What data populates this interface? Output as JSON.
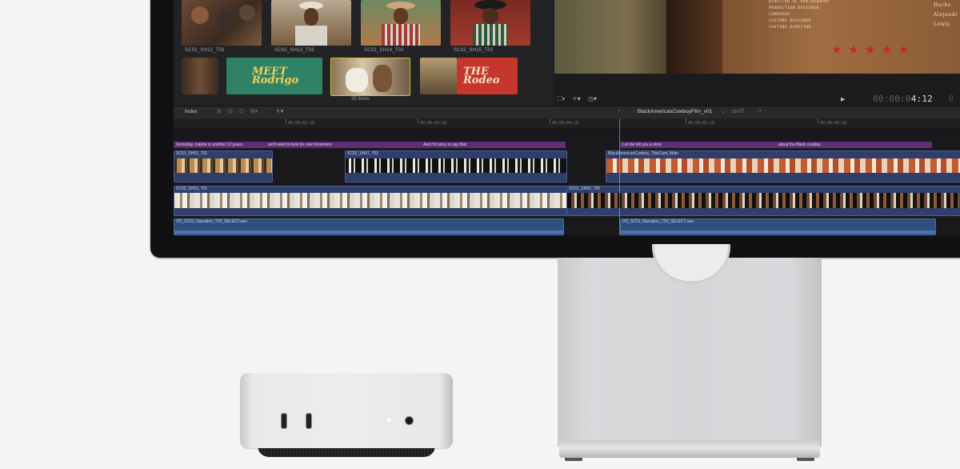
{
  "browser": {
    "clips": [
      {
        "label": "SC02_SH12_T03"
      },
      {
        "label": "SC02_SH13_T03"
      },
      {
        "label": "SC02_SH14_T02"
      },
      {
        "label": "SC02_SH15_T02"
      }
    ],
    "items_count": "35 items"
  },
  "title_cards": [
    "MEET Rodrigo",
    "THE Rodeo"
  ],
  "viewer": {
    "credits": [
      "DIRECTOR OF PHOTOGRAPHY",
      "PRODUCTION DESIGNER",
      "COMPOSER",
      "COSTUME DESIGNER",
      "CASTING DIRECTOR"
    ],
    "credit_names": [
      "Harbo",
      "Alejandr",
      "Lewis"
    ],
    "timecode_dim": "00:00:0",
    "timecode": "4:12",
    "star_rating": 5
  },
  "timeline": {
    "index_label": "Index",
    "project_name": "BlackAmericanCowboyFilm_v01",
    "project_duration": "16:07",
    "ruler": [
      "00:00:02:10",
      "00:00:03:10",
      "00:00:04:10",
      "00:00:05:10",
      "00:00:06:10"
    ],
    "captions": [
      "Someday, maybe in another 12 years,",
      "we'll need to look for new horsemen",
      "And I'm sorry to say that.",
      "Let me tell you a story",
      "about the Black cowboy."
    ],
    "clips_upper": [
      "SC01_SH01_T01",
      "SC02_SH07_T01",
      "BlackAmericanCowboy_TitleCard_Main"
    ],
    "clips_main": [
      "SC02_SH10_T01",
      "SC01_SH02_T05"
    ],
    "audio": [
      "VO_SC01_Narration_T03_SELECT.wav",
      "VO_SC01_Narration_T03_SELECT.wav"
    ]
  },
  "colors": {
    "caption": "#5f2f74",
    "clip": "#2f3e6a",
    "audio": "#2f4f7e",
    "star": "#c8262a"
  }
}
